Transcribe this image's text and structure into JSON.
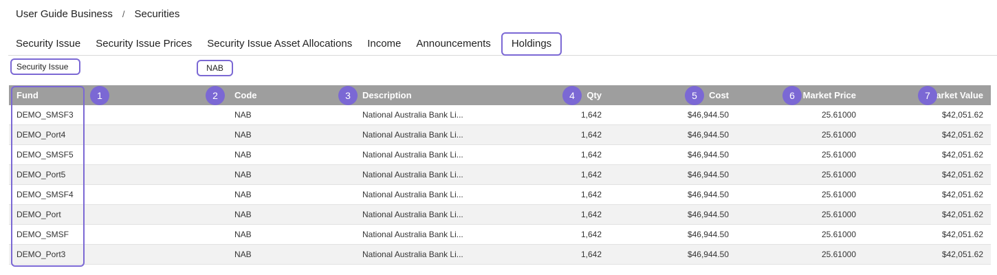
{
  "breadcrumb": {
    "root": "User Guide Business",
    "separator": "/",
    "current": "Securities"
  },
  "tabs": [
    {
      "label": "Security Issue",
      "active": false
    },
    {
      "label": "Security Issue Prices",
      "active": false
    },
    {
      "label": "Security Issue Asset Allocations",
      "active": false
    },
    {
      "label": "Income",
      "active": false
    },
    {
      "label": "Announcements",
      "active": false
    },
    {
      "label": "Holdings",
      "active": true
    }
  ],
  "filter": {
    "label": "Security Issue",
    "value": "NAB"
  },
  "table": {
    "columns": {
      "fund": "Fund",
      "code": "Code",
      "description": "Description",
      "qty": "Qty",
      "cost": "Cost",
      "market_price": "Market Price",
      "market_value": "Market Value"
    },
    "badges": [
      "1",
      "2",
      "3",
      "4",
      "5",
      "6",
      "7"
    ],
    "rows": [
      {
        "fund": "DEMO_SMSF3",
        "code": "NAB",
        "description": "National Australia Bank Li...",
        "qty": "1,642",
        "cost": "$46,944.50",
        "market_price": "25.61000",
        "market_value": "$42,051.62"
      },
      {
        "fund": "DEMO_Port4",
        "code": "NAB",
        "description": "National Australia Bank Li...",
        "qty": "1,642",
        "cost": "$46,944.50",
        "market_price": "25.61000",
        "market_value": "$42,051.62"
      },
      {
        "fund": "DEMO_SMSF5",
        "code": "NAB",
        "description": "National Australia Bank Li...",
        "qty": "1,642",
        "cost": "$46,944.50",
        "market_price": "25.61000",
        "market_value": "$42,051.62"
      },
      {
        "fund": "DEMO_Port5",
        "code": "NAB",
        "description": "National Australia Bank Li...",
        "qty": "1,642",
        "cost": "$46,944.50",
        "market_price": "25.61000",
        "market_value": "$42,051.62"
      },
      {
        "fund": "DEMO_SMSF4",
        "code": "NAB",
        "description": "National Australia Bank Li...",
        "qty": "1,642",
        "cost": "$46,944.50",
        "market_price": "25.61000",
        "market_value": "$42,051.62"
      },
      {
        "fund": "DEMO_Port",
        "code": "NAB",
        "description": "National Australia Bank Li...",
        "qty": "1,642",
        "cost": "$46,944.50",
        "market_price": "25.61000",
        "market_value": "$42,051.62"
      },
      {
        "fund": "DEMO_SMSF",
        "code": "NAB",
        "description": "National Australia Bank Li...",
        "qty": "1,642",
        "cost": "$46,944.50",
        "market_price": "25.61000",
        "market_value": "$42,051.62"
      },
      {
        "fund": "DEMO_Port3",
        "code": "NAB",
        "description": "National Australia Bank Li...",
        "qty": "1,642",
        "cost": "$46,944.50",
        "market_price": "25.61000",
        "market_value": "$42,051.62"
      }
    ]
  },
  "colors": {
    "accent": "#7b68d4",
    "header_bg": "#9e9e9e",
    "row_alt": "#f2f2f2"
  }
}
